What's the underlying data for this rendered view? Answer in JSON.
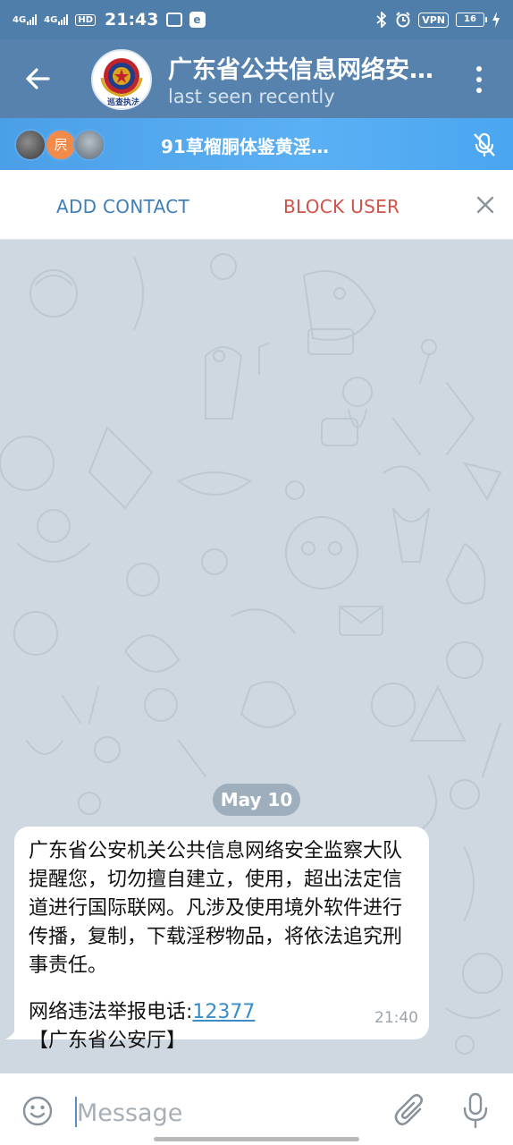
{
  "status_bar": {
    "network1": "4G",
    "network2": "4G",
    "hd": "HD",
    "time": "21:43",
    "app_badge": "e",
    "vpn": "VPN",
    "battery": "16"
  },
  "header": {
    "title": "广东省公共信息网络安…",
    "subtitle": "last seen recently",
    "avatar_caption": "巡查执法",
    "icons": [
      "back-arrow-icon",
      "more-vertical-icon"
    ]
  },
  "voice_chat": {
    "title": "91草榴胴体鉴黄淫…",
    "avatar2_text": "屄",
    "icons": [
      "mic-off-icon"
    ]
  },
  "actions": {
    "add_contact": "ADD CONTACT",
    "block_user": "BLOCK USER",
    "icons": [
      "close-icon"
    ]
  },
  "chat": {
    "date": "May 10",
    "message": {
      "body": "广东省公安机关公共信息网络安全监察大队提醒您，切勿擅自建立，使用，超出法定信道进行国际联网。凡涉及使用境外软件进行传播，复制，下载淫秽物品，将依法追究刑事责任。",
      "report_label": "网络违法举报电话:",
      "report_number": "12377",
      "signature": "【广东省公安厅】",
      "time": "21:40"
    }
  },
  "composer": {
    "placeholder": "Message",
    "icons": [
      "emoji-icon",
      "attach-icon",
      "microphone-icon"
    ]
  },
  "colors": {
    "header": "#5682ad",
    "status_bar": "#4f7eab",
    "voice_bar": "#4a9fe7",
    "add_contact": "#3f7fb7",
    "block_user": "#d0524a",
    "chat_bg": "#cfd8e1"
  }
}
